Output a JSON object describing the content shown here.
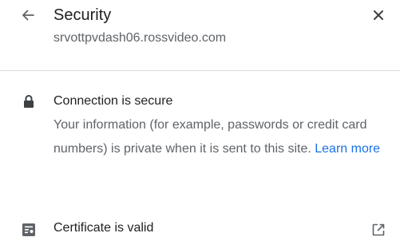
{
  "header": {
    "title": "Security",
    "subtitle": "srvottpvdash06.rossvideo.com",
    "back_icon": "arrow-back-icon",
    "close_icon": "close-icon"
  },
  "connection": {
    "icon": "lock-icon",
    "title": "Connection is secure",
    "description": "Your information (for example, passwords or credit card numbers) is private when it is sent to this site.",
    "learn_more": "Learn more"
  },
  "certificate": {
    "icon": "certificate-icon",
    "label": "Certificate is valid",
    "external_icon": "open-external-icon"
  },
  "colors": {
    "primary_text": "#202124",
    "secondary_text": "#5f6368",
    "link": "#1a73e8",
    "divider": "#dadce0",
    "icon": "#5f6368"
  }
}
